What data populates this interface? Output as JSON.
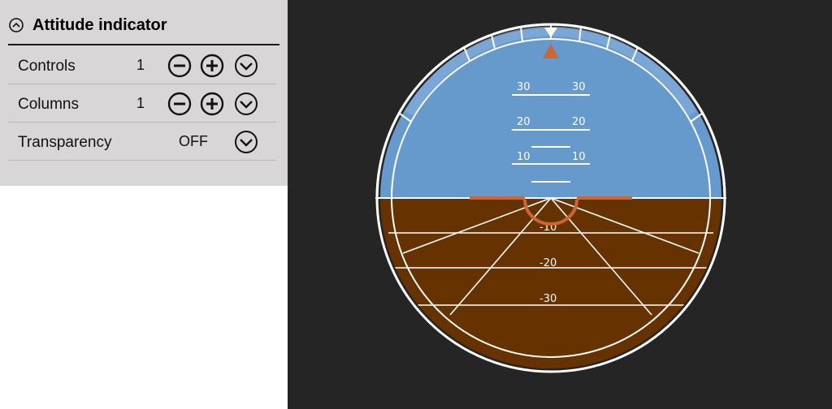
{
  "panel": {
    "title": "Attitude indicator",
    "rows": [
      {
        "label": "Controls",
        "value": "1"
      },
      {
        "label": "Columns",
        "value": "1"
      },
      {
        "label": "Transparency",
        "value": "OFF"
      }
    ]
  },
  "indicator": {
    "pitch_labels_up": [
      "10",
      "20",
      "30"
    ],
    "pitch_labels_down": [
      "-10",
      "-20",
      "-30"
    ],
    "colors": {
      "sky": "#6699cc",
      "ground": "#663300",
      "aircraft_symbol": "#cc6633",
      "markings": "#ffffff",
      "background": "#252525"
    }
  },
  "icons": {
    "collapse": "collapse-circle-icon",
    "minus": "minus-circle-icon",
    "plus": "plus-circle-icon",
    "dropdown": "chevron-down-circle-icon"
  }
}
